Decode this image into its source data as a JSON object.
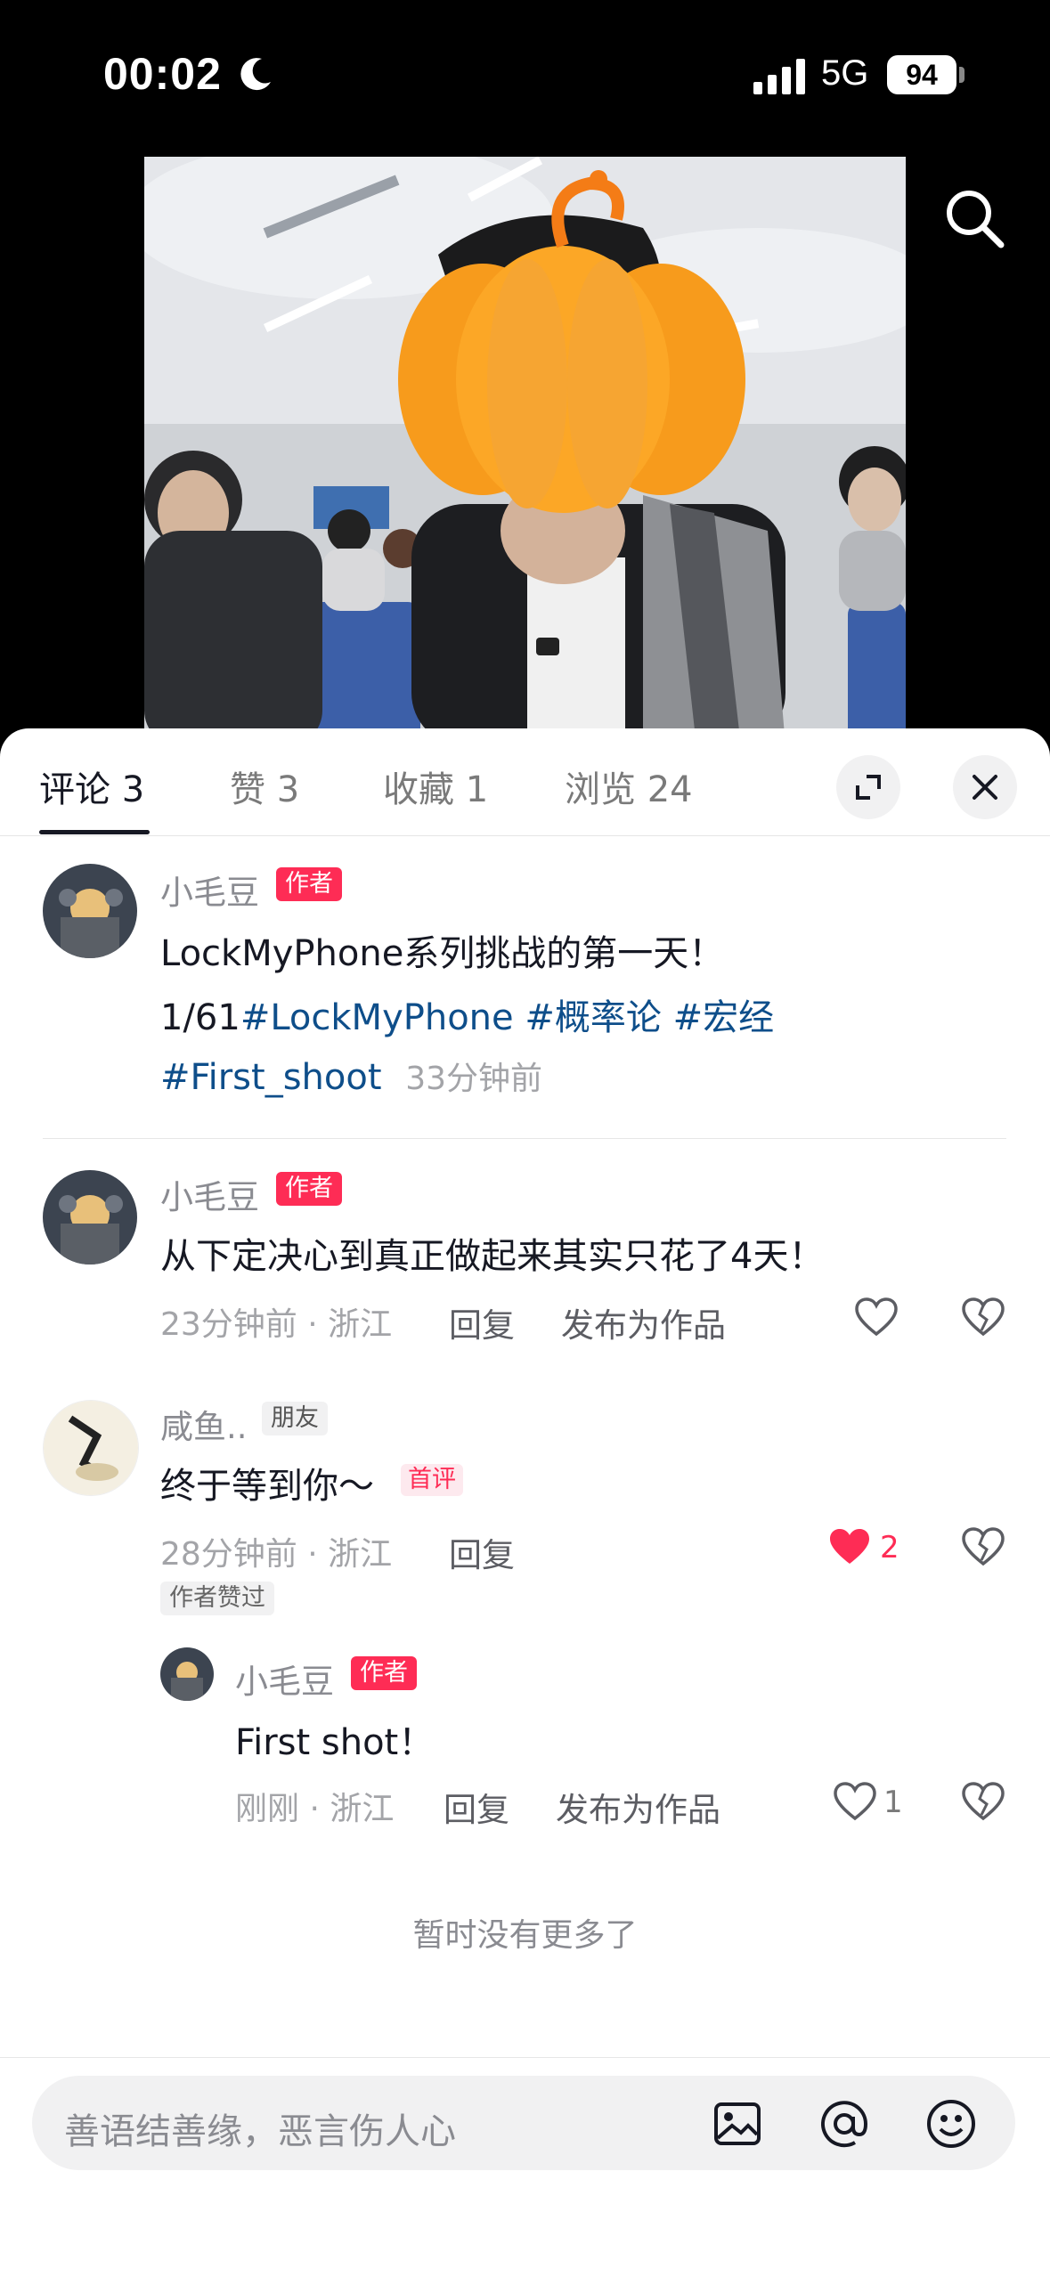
{
  "status_bar": {
    "time": "00:02",
    "network": "5G",
    "battery": "94"
  },
  "tabs": [
    {
      "label": "评论 3"
    },
    {
      "label": "赞 3"
    },
    {
      "label": "收藏 1"
    },
    {
      "label": "浏览 24"
    }
  ],
  "comments": [
    {
      "author": "小毛豆",
      "badge": "作者",
      "line1": "LockMyPhone系列挑战的第一天！",
      "line2_plain": "1/61",
      "line2_tags": "#LockMyPhone #概率论 #宏经",
      "line3_tag": "#First_shoot",
      "time": "33分钟前"
    },
    {
      "author": "小毛豆",
      "badge": "作者",
      "text": "从下定决心到真正做起来其实只花了4天！",
      "meta": "23分钟前 · 浙江",
      "reply": "回复",
      "publish": "发布为作品"
    },
    {
      "author": "咸鱼..",
      "badge": "朋友",
      "text": "终于等到你～",
      "first_badge": "首评",
      "meta": "28分钟前 · 浙江",
      "reply": "回复",
      "likes": "2",
      "liked_by_author": "作者赞过"
    }
  ],
  "reply": {
    "author": "小毛豆",
    "badge": "作者",
    "text": "First shot！",
    "meta": "刚刚 · 浙江",
    "reply": "回复",
    "publish": "发布为作品",
    "likes": "1"
  },
  "no_more": "暂时没有更多了",
  "input": {
    "placeholder": "善语结善缘，恶言伤人心"
  }
}
